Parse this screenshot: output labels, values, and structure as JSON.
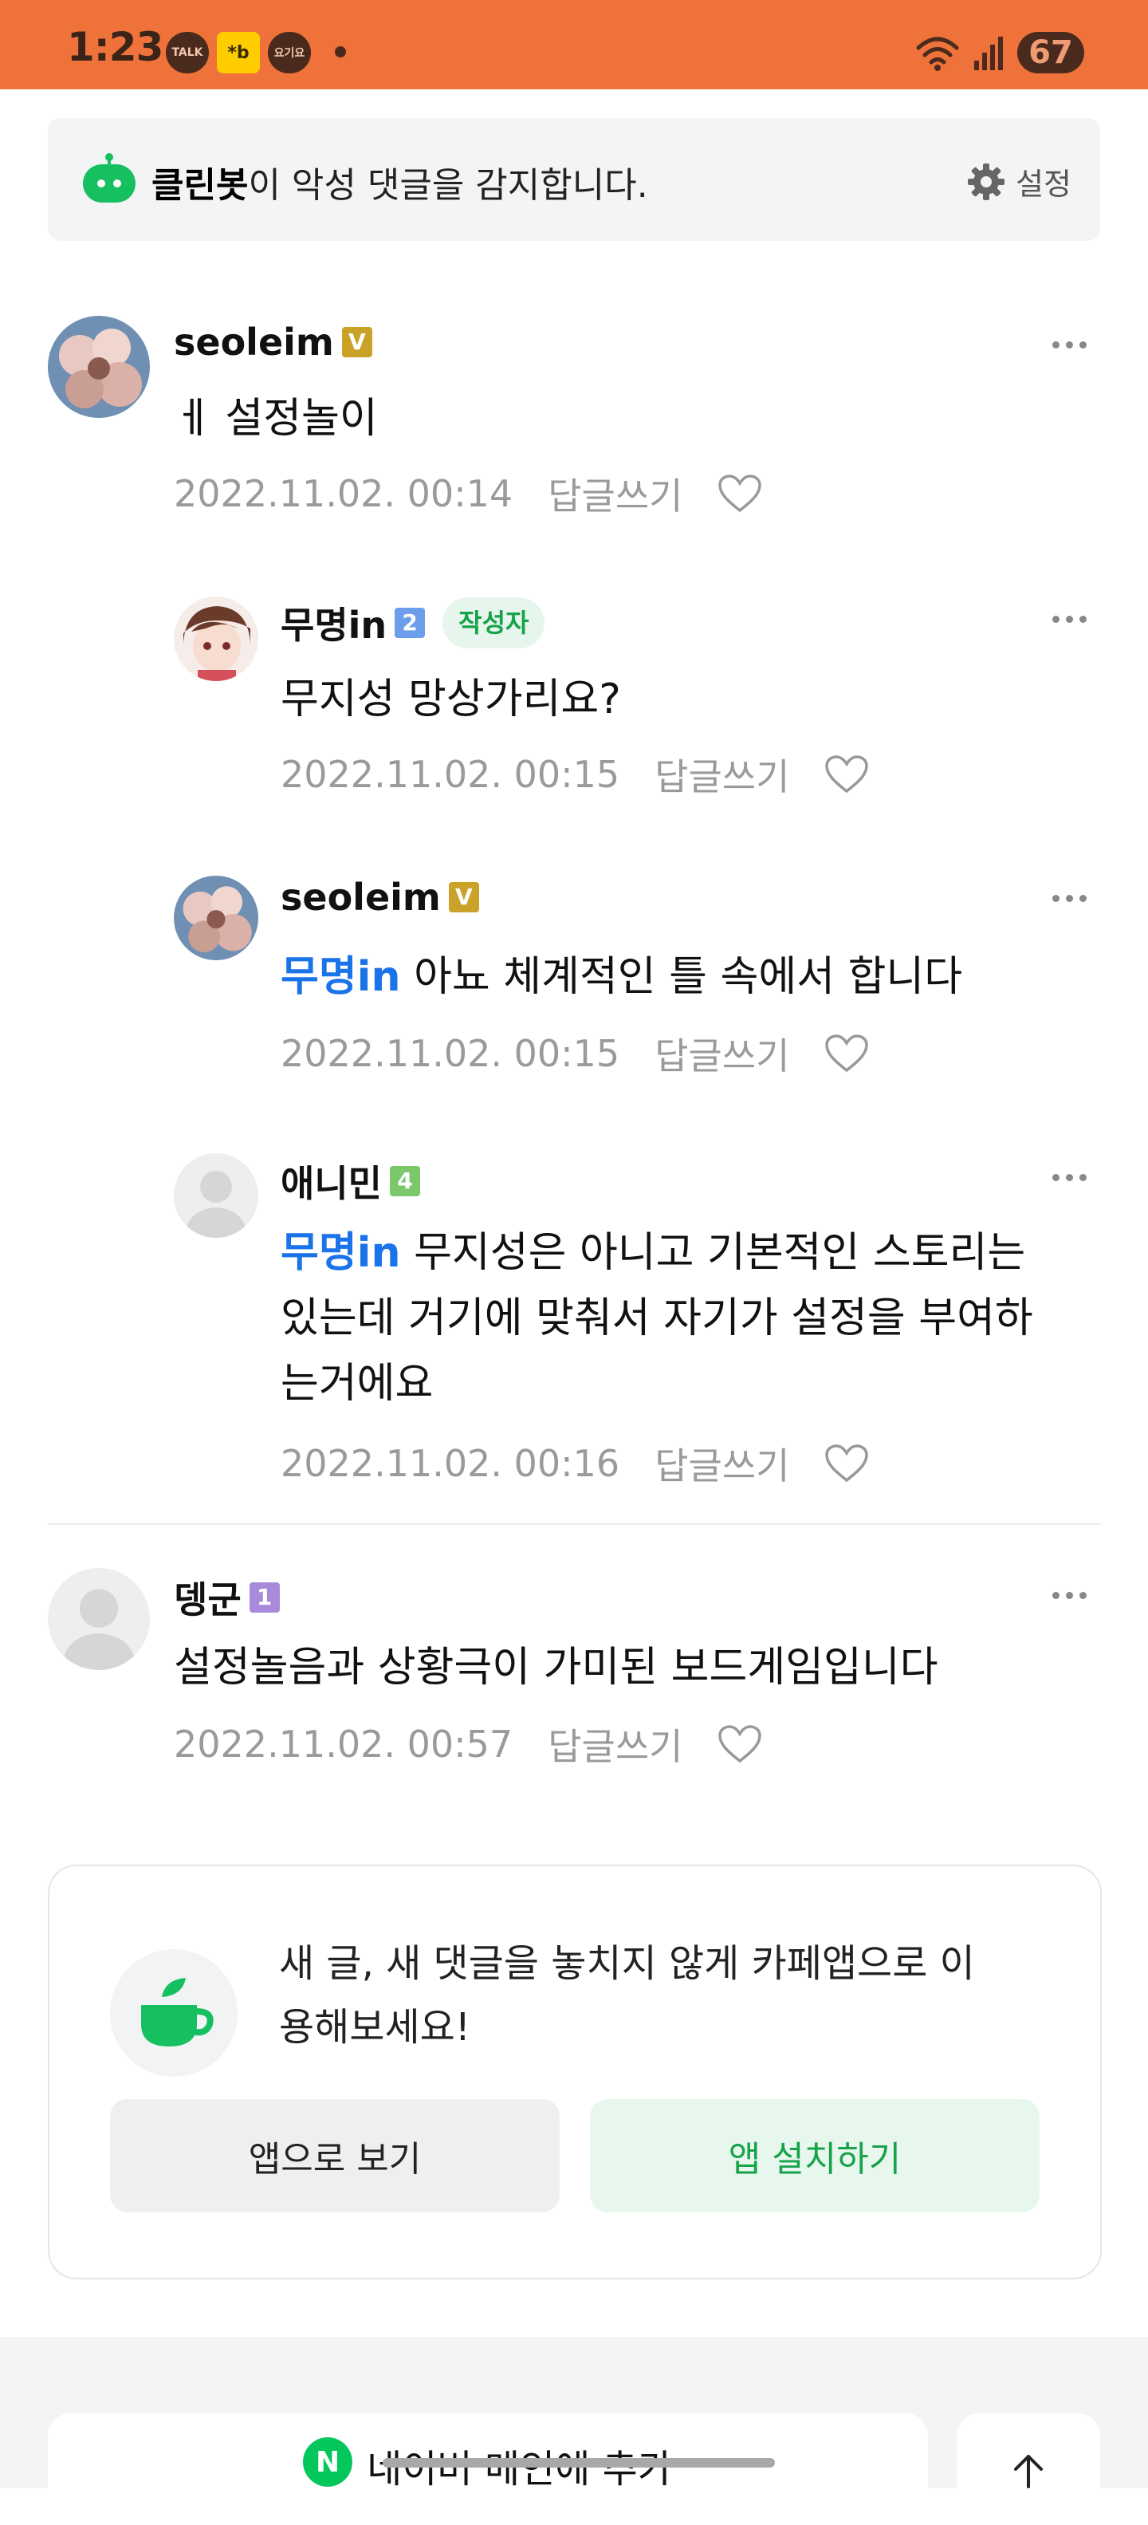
{
  "status_bar": {
    "time": "1:23",
    "notif_talk": "TALK",
    "notif_kb": "*b",
    "notif_yo": "요기요",
    "battery": "67"
  },
  "cleanbot": {
    "name": "클린봇",
    "message": "이 악성 댓글을 감지합니다.",
    "settings_label": "설정"
  },
  "comments": [
    {
      "author": "seoleim",
      "level": "V",
      "level_color": "#c9a227",
      "text": "ㅔ 설정놀이",
      "date": "2022.11.02. 00:14",
      "reply_label": "답글쓰기"
    },
    {
      "author": "무명in",
      "level": "2",
      "level_color": "#6d9eeb",
      "badge": "작성자",
      "text": "무지성 망상가리요?",
      "date": "2022.11.02. 00:15",
      "reply_label": "답글쓰기"
    },
    {
      "author": "seoleim",
      "level": "V",
      "level_color": "#c9a227",
      "mention": "무명in",
      "text": "아뇨 체계적인 틀 속에서 합니다",
      "date": "2022.11.02. 00:15",
      "reply_label": "답글쓰기"
    },
    {
      "author": "애니민",
      "level": "4",
      "level_color": "#7bc86c",
      "mention": "무명in",
      "text_line1": "무지성은 아니고 기본적인 스토리는",
      "text_line2": "있는데 거기에 맞춰서 자기가 설정을 부여하",
      "text_line3": "는거에요",
      "date": "2022.11.02. 00:16",
      "reply_label": "답글쓰기"
    },
    {
      "author": "뎅군",
      "level": "1",
      "level_color": "#a78bda",
      "text": "설정놀음과 상황극이 가미된 보드게임입니다",
      "date": "2022.11.02. 00:57",
      "reply_label": "답글쓰기"
    }
  ],
  "promo": {
    "message_line1": "새 글, 새 댓글을 놓치지 않게 카페앱으로 이",
    "message_line2": "용해보세요!",
    "open_app_label": "앱으로 보기",
    "install_app_label": "앱 설치하기"
  },
  "bottom": {
    "naver_add_label": "네이버 메인에 추가",
    "naver_logo": "N"
  }
}
